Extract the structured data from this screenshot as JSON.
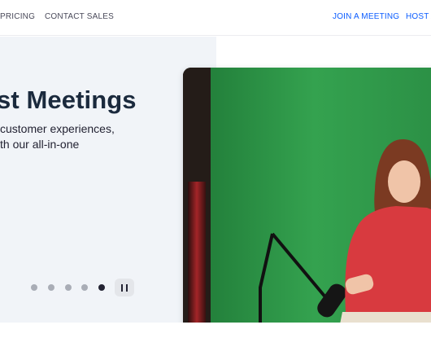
{
  "nav": {
    "left": [
      "PRICING",
      "CONTACT SALES"
    ],
    "right": [
      "JOIN A MEETING",
      "HOST A"
    ]
  },
  "hero": {
    "headline": "st Meetings",
    "subline_1": "customer experiences,",
    "subline_2": "th our all-in-one",
    "carousel": {
      "slide_count": 5,
      "active_index": 4
    }
  },
  "video": {
    "icons": [
      "microphone-icon"
    ]
  },
  "colors": {
    "accent": "#0b5cff",
    "headline": "#1b2a3d",
    "hero_bg": "#f1f4f8",
    "green_screen": "#2f9a4a"
  }
}
